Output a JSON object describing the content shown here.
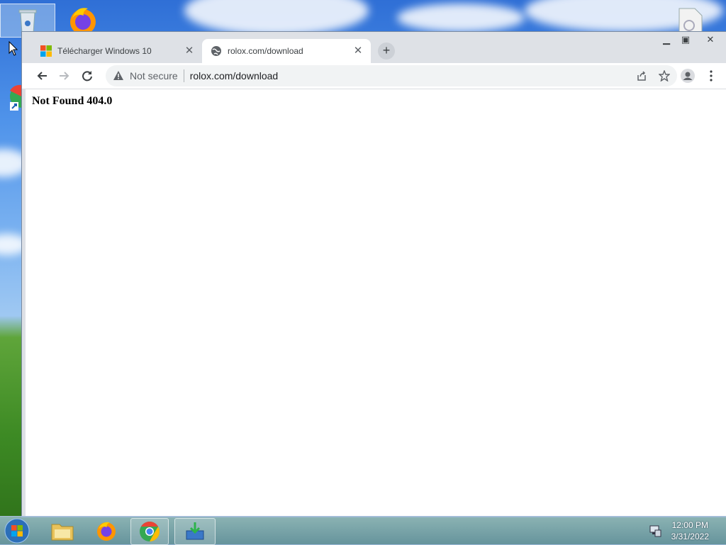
{
  "browser": {
    "tabs": [
      {
        "title": "Télécharger Windows 10",
        "icon": "windows-logo-icon",
        "active": false
      },
      {
        "title": "rolox.com/download",
        "icon": "globe-icon",
        "active": true
      }
    ],
    "omnibox": {
      "security_label": "Not secure",
      "url": "rolox.com/download"
    }
  },
  "page": {
    "message": "Not Found 404.0"
  },
  "taskbar": {
    "time": "12:00 PM",
    "date": "3/31/2022"
  },
  "colors": {
    "accent": "#1a73e8",
    "tab_bg": "#dee1e6",
    "omnibox_bg": "#f1f3f4"
  }
}
